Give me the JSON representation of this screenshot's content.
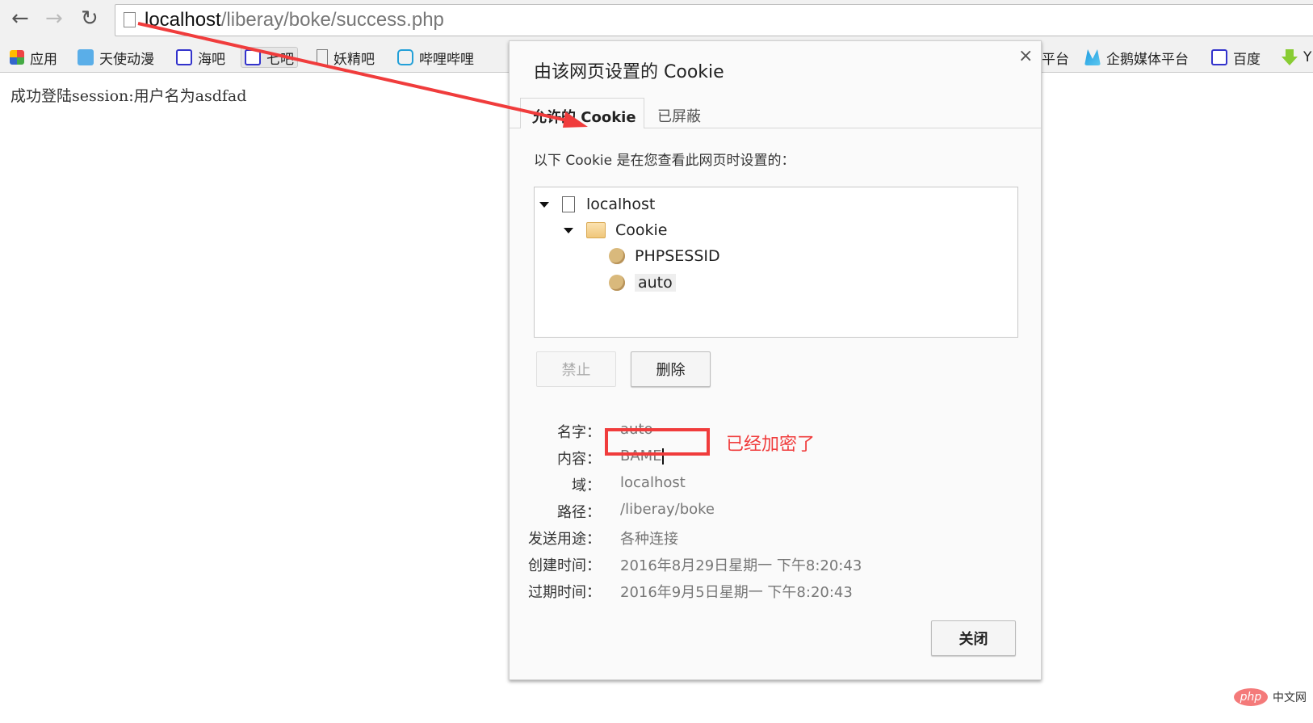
{
  "browser": {
    "url_host": "localhost",
    "url_path": "/liberay/boke/success.php",
    "bookmarks": [
      {
        "label": "应用",
        "icon": "apps-grid-icon"
      },
      {
        "label": "天使动漫",
        "icon": "feather-icon"
      },
      {
        "label": "海吧",
        "icon": "baidu-paw-icon"
      },
      {
        "label": "七吧",
        "icon": "baidu-paw-icon"
      },
      {
        "label": "妖精吧",
        "icon": "page-icon"
      },
      {
        "label": "哔哩哔哩",
        "icon": "bilibili-tv-icon"
      },
      {
        "label": "平台",
        "icon": ""
      },
      {
        "label": "企鹅媒体平台",
        "icon": "penguin-media-icon"
      },
      {
        "label": "百度",
        "icon": "baidu-paw-icon"
      },
      {
        "label": "Y",
        "icon": "download-arrow-icon"
      }
    ]
  },
  "page": {
    "text": "成功登陆session:用户名为asdfad"
  },
  "dialog": {
    "title": "由该网页设置的 Cookie",
    "close": "×",
    "tabs": [
      "允许的 Cookie",
      "已屏蔽"
    ],
    "description": "以下 Cookie 是在您查看此网页时设置的：",
    "tree": {
      "site": "localhost",
      "folder": "Cookie",
      "cookies": [
        "PHPSESSID",
        "auto"
      ]
    },
    "buttons": {
      "block": "禁止",
      "delete": "删除",
      "close": "关闭"
    },
    "details": [
      {
        "label": "名字：",
        "value": "auto"
      },
      {
        "label": "内容：",
        "value": "BAME"
      },
      {
        "label": "域：",
        "value": "localhost"
      },
      {
        "label": "路径：",
        "value": "/liberay/boke"
      },
      {
        "label": "发送用途：",
        "value": "各种连接"
      },
      {
        "label": "创建时间：",
        "value": "2016年8月29日星期一 下午8:20:43"
      },
      {
        "label": "过期时间：",
        "value": "2016年9月5日星期一 下午8:20:43"
      }
    ]
  },
  "annotation": {
    "text": "已经加密了",
    "color": "#f03c3c"
  },
  "watermark": {
    "logo": "php",
    "text": "中文网"
  }
}
